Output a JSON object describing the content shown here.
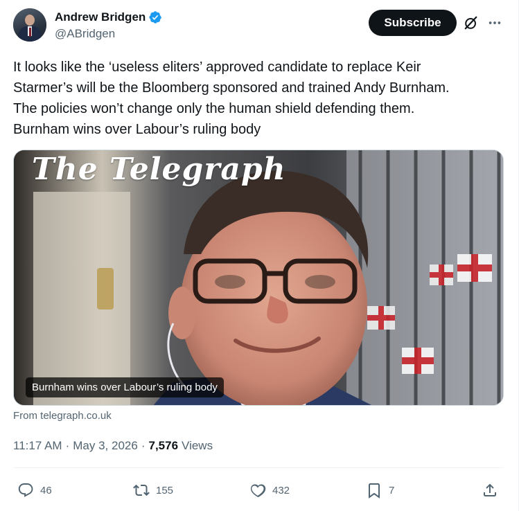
{
  "author": {
    "display_name": "Andrew Bridgen",
    "handle": "@ABridgen",
    "verified_icon": "verified-badge-icon",
    "verified_color": "#1d9bf0"
  },
  "header": {
    "subscribe_label": "Subscribe"
  },
  "tweet": {
    "text": "It looks like the ‘useless eliters’ approved candidate to replace Keir\nStarmer’s will be the Bloomberg sponsored and trained Andy Burnham.\nThe policies won’t change only the human shield defending them.\nBurnham wins over Labour’s ruling body"
  },
  "card": {
    "masthead": "The Telegraph",
    "caption": "Burnham wins over Labour’s ruling body",
    "source": "From telegraph.co.uk"
  },
  "meta": {
    "time": "11:17 AM",
    "separator": "·",
    "date": "May 3, 2026",
    "views_count": "7,576",
    "views_label": "Views"
  },
  "actions": {
    "replies": "46",
    "reposts": "155",
    "likes": "432",
    "bookmarks": "7"
  },
  "colors": {
    "text_primary": "#0f1419",
    "text_secondary": "#536471",
    "button_dark": "#0f1419",
    "border": "#cfd9de"
  }
}
